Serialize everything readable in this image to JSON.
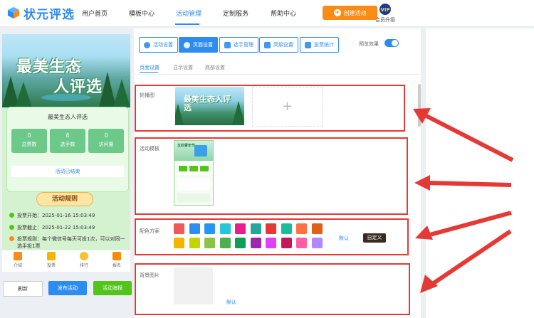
{
  "brand": {
    "name": "状元评选",
    "accent": "#2d8cf0"
  },
  "nav": {
    "items": [
      "用户首页",
      "模板中心",
      "活动管理",
      "定制服务",
      "帮助中心"
    ],
    "active": "活动管理"
  },
  "header": {
    "create_label": "创建活动",
    "vip_label": "会员升级",
    "vip_badge": "VIP"
  },
  "preview": {
    "hero_line1": "最美生态",
    "hero_line2": "人评选",
    "activity_name": "最美生态人评选",
    "stats": [
      {
        "value": "0",
        "label": "总票数"
      },
      {
        "value": "6",
        "label": "选手数"
      },
      {
        "value": "0",
        "label": "访问量"
      }
    ],
    "ended_label": "活动已结束",
    "rules_title": "活动规则",
    "rules": [
      {
        "text": "投票开始：2025-01-16 15:03:49",
        "color": "#52c41a"
      },
      {
        "text": "投票截止：2025-01-22 15:03:49",
        "color": "#52c41a"
      },
      {
        "text": "投票规则：每个微信号每天可投1次，可以对同一选手投1票",
        "color": "#fa8c16"
      }
    ],
    "bottom_tabs": [
      "介绍",
      "投票",
      "排行",
      "报名"
    ],
    "refresh_label": "刷新",
    "publish_label": "发布活动",
    "poster_label": "活动海报"
  },
  "toolbar": {
    "buttons": [
      "活动设置",
      "页面设置",
      "选手管理",
      "高级设置",
      "投票统计"
    ],
    "active": "页面设置",
    "preview_label": "预览效果",
    "preview_enabled": true
  },
  "subtabs": {
    "items": [
      "页面设置",
      "显示设置",
      "底部设置"
    ],
    "active": "页面设置"
  },
  "sections": {
    "carousel_label": "轮播图",
    "carousel_image_text": "最美生态人评选",
    "template_label": "活动模板",
    "template_thumb_text": "五四青年节",
    "color_label": "配色方案",
    "default_label": "默认",
    "custom_label": "自定义",
    "bg_label": "背景图片",
    "bg_default_label": "默认"
  },
  "swatches": {
    "row1": [
      "#f0595c",
      "#2d8cf0",
      "#2196f3",
      "#26c6da",
      "#e91e8c",
      "#26a69a",
      "#e53935",
      "#1abc9c",
      "#ff7043",
      "#e0601a"
    ],
    "row2": [
      "#f4b400",
      "#c0d400",
      "#8bc34a",
      "#4caf50",
      "#0f9d58",
      "#9c27b0",
      "#e040fb",
      "#c2185b",
      "#ff5fa2",
      "#b388ff"
    ]
  },
  "annotation_color": "#e53935"
}
